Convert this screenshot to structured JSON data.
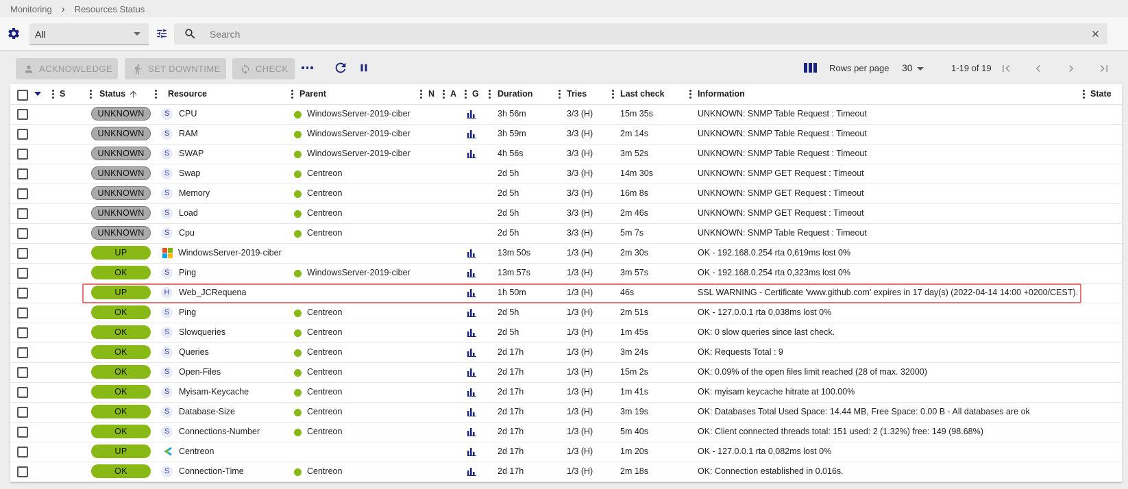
{
  "breadcrumb": {
    "root": "Monitoring",
    "current": "Resources Status"
  },
  "filter": {
    "selected": "All",
    "search_placeholder": "Search",
    "search_value": ""
  },
  "toolbar": {
    "acknowledge": "ACKNOWLEDGE",
    "set_downtime": "SET DOWNTIME",
    "check": "CHECK",
    "rows_per_page_label": "Rows per page",
    "rows_per_page_value": "30",
    "range": "1-19 of 19"
  },
  "columns": {
    "s": "S",
    "status": "Status",
    "resource": "Resource",
    "parent": "Parent",
    "n": "N",
    "a": "A",
    "g": "G",
    "duration": "Duration",
    "tries": "Tries",
    "last_check": "Last check",
    "information": "Information",
    "state": "State"
  },
  "colors": {
    "accent": "#1a237e",
    "ok": "#88b917",
    "unknown": "#aaaaaa",
    "highlight": "#e57373"
  },
  "rows": [
    {
      "status": "UNKNOWN",
      "type": "S",
      "resource": "CPU",
      "parent": "WindowsServer-2019-ciber",
      "graph": true,
      "duration": "3h 56m",
      "tries": "3/3 (H)",
      "last_check": "15m 35s",
      "information": "UNKNOWN: SNMP Table Request : Timeout"
    },
    {
      "status": "UNKNOWN",
      "type": "S",
      "resource": "RAM",
      "parent": "WindowsServer-2019-ciber",
      "graph": true,
      "duration": "3h 59m",
      "tries": "3/3 (H)",
      "last_check": "2m 14s",
      "information": "UNKNOWN: SNMP Table Request : Timeout"
    },
    {
      "status": "UNKNOWN",
      "type": "S",
      "resource": "SWAP",
      "parent": "WindowsServer-2019-ciber",
      "graph": true,
      "duration": "4h 56s",
      "tries": "3/3 (H)",
      "last_check": "3m 52s",
      "information": "UNKNOWN: SNMP Table Request : Timeout"
    },
    {
      "status": "UNKNOWN",
      "type": "S",
      "resource": "Swap",
      "parent": "Centreon",
      "graph": false,
      "duration": "2d 5h",
      "tries": "3/3 (H)",
      "last_check": "14m 30s",
      "information": "UNKNOWN: SNMP GET Request : Timeout"
    },
    {
      "status": "UNKNOWN",
      "type": "S",
      "resource": "Memory",
      "parent": "Centreon",
      "graph": false,
      "duration": "2d 5h",
      "tries": "3/3 (H)",
      "last_check": "16m 8s",
      "information": "UNKNOWN: SNMP GET Request : Timeout"
    },
    {
      "status": "UNKNOWN",
      "type": "S",
      "resource": "Load",
      "parent": "Centreon",
      "graph": false,
      "duration": "2d 5h",
      "tries": "3/3 (H)",
      "last_check": "2m 46s",
      "information": "UNKNOWN: SNMP GET Request : Timeout"
    },
    {
      "status": "UNKNOWN",
      "type": "S",
      "resource": "Cpu",
      "parent": "Centreon",
      "graph": false,
      "duration": "2d 5h",
      "tries": "3/3 (H)",
      "last_check": "5m 7s",
      "information": "UNKNOWN: SNMP Table Request : Timeout"
    },
    {
      "status": "UP",
      "type": "windows-logo",
      "resource": "WindowsServer-2019-ciber",
      "parent": "",
      "graph": true,
      "duration": "13m 50s",
      "tries": "1/3 (H)",
      "last_check": "2m 30s",
      "information": "OK - 192.168.0.254 rta 0,619ms lost 0%"
    },
    {
      "status": "OK",
      "type": "S",
      "resource": "Ping",
      "parent": "WindowsServer-2019-ciber",
      "graph": true,
      "duration": "13m 57s",
      "tries": "1/3 (H)",
      "last_check": "3m 57s",
      "information": "OK - 192.168.0.254 rta 0,323ms lost 0%"
    },
    {
      "status": "UP",
      "type": "H",
      "resource": "Web_JCRequena",
      "parent": "",
      "graph": true,
      "duration": "1h 50m",
      "tries": "1/3 (H)",
      "last_check": "46s",
      "information": "SSL WARNING - Certificate 'www.github.com' expires in 17 day(s) (2022-04-14 14:00 +0200/CEST)."
    },
    {
      "status": "OK",
      "type": "S",
      "resource": "Ping",
      "parent": "Centreon",
      "graph": true,
      "duration": "2d 5h",
      "tries": "1/3 (H)",
      "last_check": "2m 51s",
      "information": "OK - 127.0.0.1 rta 0,038ms lost 0%"
    },
    {
      "status": "OK",
      "type": "S",
      "resource": "Slowqueries",
      "parent": "Centreon",
      "graph": true,
      "duration": "2d 5h",
      "tries": "1/3 (H)",
      "last_check": "1m 45s",
      "information": "OK: 0 slow queries since last check."
    },
    {
      "status": "OK",
      "type": "S",
      "resource": "Queries",
      "parent": "Centreon",
      "graph": true,
      "duration": "2d 17h",
      "tries": "1/3 (H)",
      "last_check": "3m 24s",
      "information": "OK: Requests Total : 9"
    },
    {
      "status": "OK",
      "type": "S",
      "resource": "Open-Files",
      "parent": "Centreon",
      "graph": true,
      "duration": "2d 17h",
      "tries": "1/3 (H)",
      "last_check": "15m 2s",
      "information": "OK: 0.09% of the open files limit reached (28 of max. 32000)"
    },
    {
      "status": "OK",
      "type": "S",
      "resource": "Myisam-Keycache",
      "parent": "Centreon",
      "graph": true,
      "duration": "2d 17h",
      "tries": "1/3 (H)",
      "last_check": "1m 41s",
      "information": "OK: myisam keycache hitrate at 100.00%"
    },
    {
      "status": "OK",
      "type": "S",
      "resource": "Database-Size",
      "parent": "Centreon",
      "graph": true,
      "duration": "2d 17h",
      "tries": "1/3 (H)",
      "last_check": "3m 19s",
      "information": "OK: Databases Total Used Space: 14.44 MB, Free Space: 0.00 B - All databases are ok"
    },
    {
      "status": "OK",
      "type": "S",
      "resource": "Connections-Number",
      "parent": "Centreon",
      "graph": true,
      "duration": "2d 17h",
      "tries": "1/3 (H)",
      "last_check": "5m 40s",
      "information": "OK: Client connected threads total: 151 used: 2 (1.32%) free: 149 (98.68%)"
    },
    {
      "status": "UP",
      "type": "centreon-logo",
      "resource": "Centreon",
      "parent": "",
      "graph": true,
      "duration": "2d 17h",
      "tries": "1/3 (H)",
      "last_check": "1m 20s",
      "information": "OK - 127.0.0.1 rta 0,082ms lost 0%"
    },
    {
      "status": "OK",
      "type": "S",
      "resource": "Connection-Time",
      "parent": "Centreon",
      "graph": true,
      "duration": "2d 17h",
      "tries": "1/3 (H)",
      "last_check": "2m 18s",
      "information": "OK: Connection established in 0.016s."
    }
  ]
}
